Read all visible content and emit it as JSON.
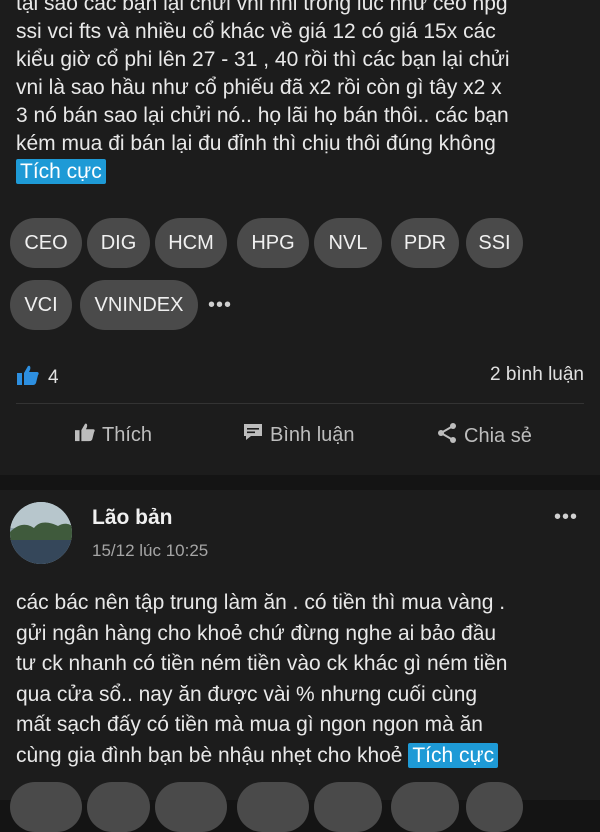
{
  "post1": {
    "text_lines": [
      "tại sao các bạn lại chửi vni nhỉ trong lúc như ceo hpg",
      "ssi vci fts và nhiều cổ khác về giá 12  có giá 15x các",
      "kiểu giờ cổ phi lên 27 - 31 , 40 rồi thì các bạn lại chửi",
      "vni là sao hầu như cổ phiếu đã x2 rồi còn gì tây x2 x",
      "3 nó bán sao lại chửi nó.. họ lãi họ bán thôi.. các bạn",
      "kém mua đi bán lại đu đỉnh thì chịu thôi đúng không"
    ],
    "sentiment": "Tích cực",
    "tags": [
      "CEO",
      "DIG",
      "HCM",
      "HPG",
      "NVL",
      "PDR",
      "SSI",
      "VCI",
      "VNINDEX"
    ],
    "more_tags": "•••",
    "like_count": "4",
    "comment_count": "2 bình luận",
    "actions": {
      "like": "Thích",
      "comment": "Bình luận",
      "share": "Chia sẻ"
    }
  },
  "post2": {
    "author": "Lão bản",
    "time": "15/12 lúc 10:25",
    "menu": "•••",
    "text_lines": [
      "các bác nên tập trung làm ăn . có tiền thì mua vàng .",
      "gửi ngân hàng cho khoẻ chứ đừng nghe ai bảo đầu",
      "tư ck nhanh có tiền ném tiền vào ck khác gì ném tiền",
      "qua cửa sổ.. nay ăn được vài % nhưng cuối cùng",
      "mất sạch đấy có tiền mà mua gì ngon ngon mà ăn",
      "cùng gia đình bạn bè nhậu nhẹt cho khoẻ"
    ],
    "sentiment": "Tích cực"
  },
  "colors": {
    "background": "#141414",
    "card": "#1c1c1c",
    "chip": "#4a4a4a",
    "accent": "#1e9ad6",
    "like_icon": "#2d8fe0"
  }
}
